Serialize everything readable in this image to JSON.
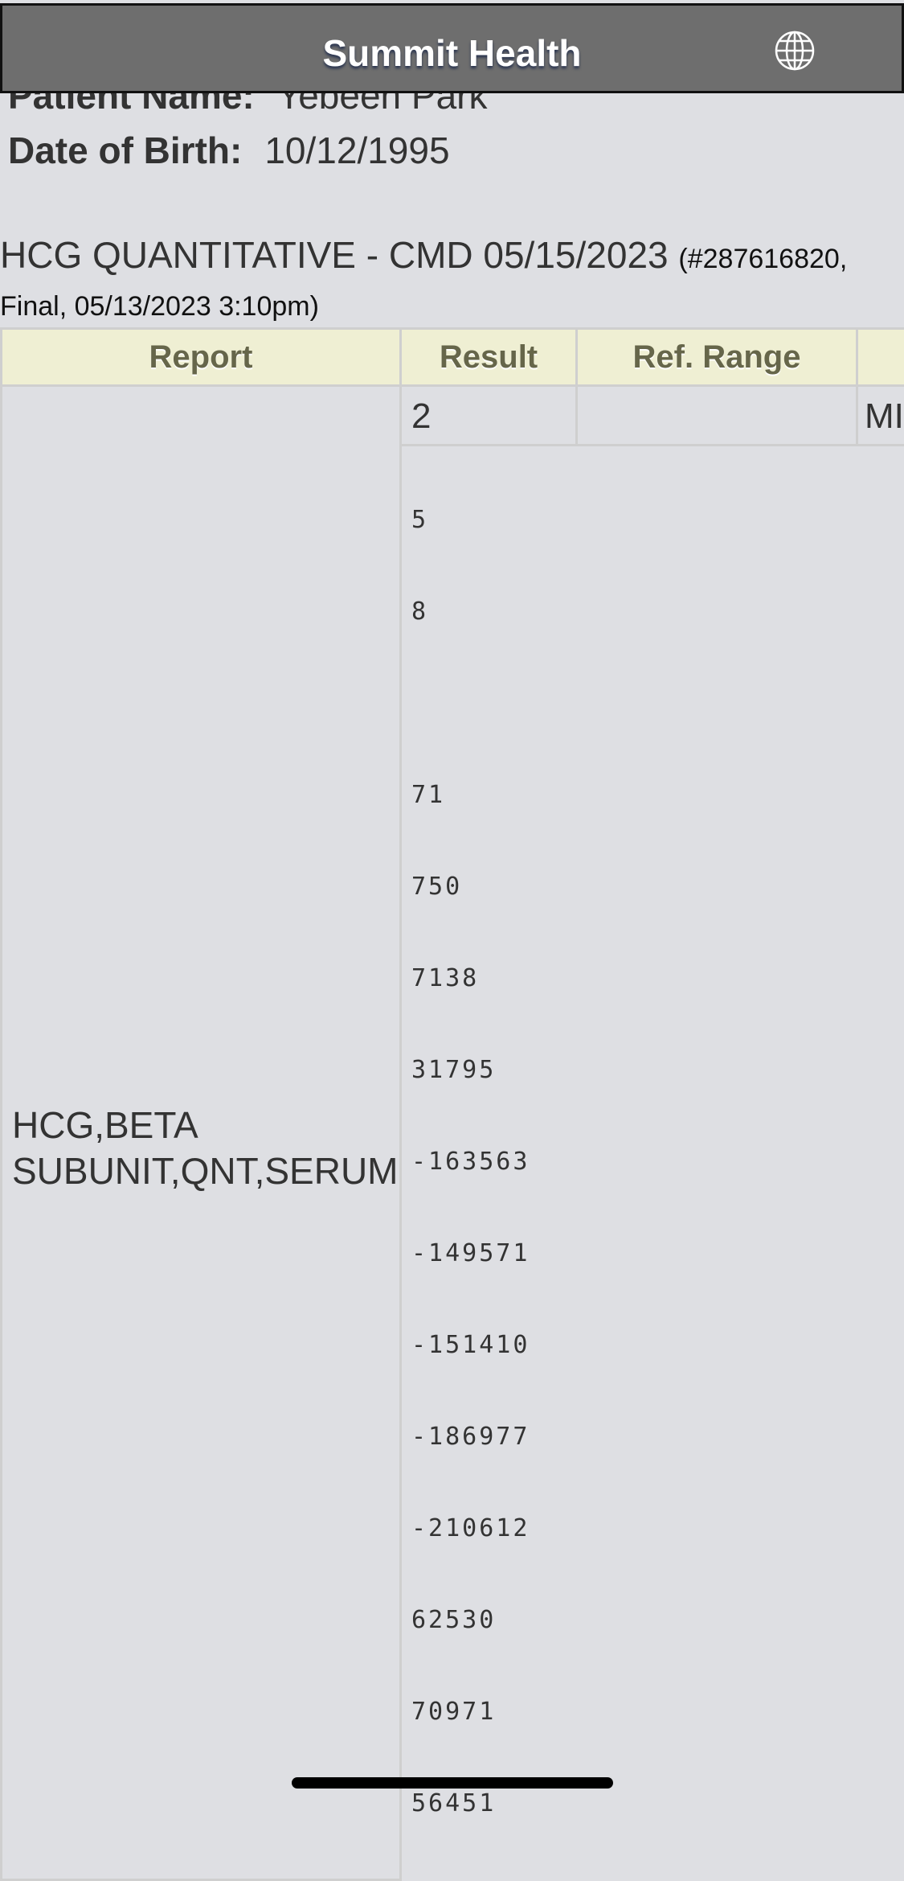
{
  "header": {
    "title": "Summit Health",
    "icon": "globe-icon"
  },
  "patient": {
    "name_label": "Patient Name:",
    "name_value": "Yebeen Park",
    "dob_label": "Date of Birth:",
    "dob_value": "10/12/1995"
  },
  "lab": {
    "title": "HCG QUANTITATIVE - CMD 05/15/2023",
    "id": "(#287616820,",
    "status_line": "Final, 05/13/2023 3:10pm)"
  },
  "table": {
    "headers": [
      "Report",
      "Result",
      "Ref. Range",
      ""
    ],
    "report_name": "HCG,BETA SUBUNIT,QNT,SERUM",
    "first_result": "2",
    "first_ref_range": "",
    "first_unit": "MI",
    "values": [
      "5",
      "8",
      "",
      "71",
      "750",
      "7138",
      "31795",
      "-163563",
      "-149571",
      "-151410",
      "-186977",
      "-210612",
      "62530",
      "70971",
      "56451"
    ]
  }
}
